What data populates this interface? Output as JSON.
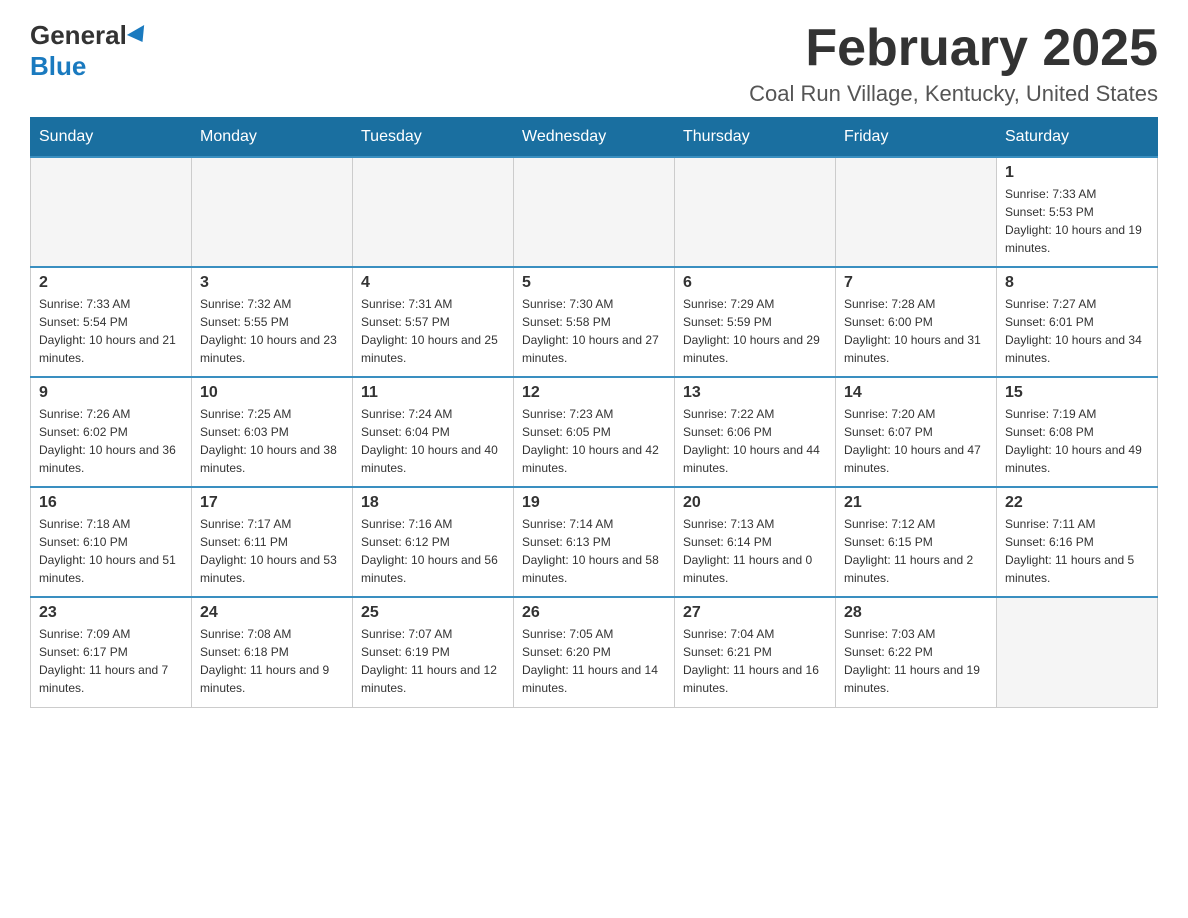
{
  "header": {
    "logo_general": "General",
    "logo_blue": "Blue",
    "month_title": "February 2025",
    "location": "Coal Run Village, Kentucky, United States"
  },
  "days_of_week": [
    "Sunday",
    "Monday",
    "Tuesday",
    "Wednesday",
    "Thursday",
    "Friday",
    "Saturday"
  ],
  "weeks": [
    [
      {
        "day": "",
        "info": ""
      },
      {
        "day": "",
        "info": ""
      },
      {
        "day": "",
        "info": ""
      },
      {
        "day": "",
        "info": ""
      },
      {
        "day": "",
        "info": ""
      },
      {
        "day": "",
        "info": ""
      },
      {
        "day": "1",
        "info": "Sunrise: 7:33 AM\nSunset: 5:53 PM\nDaylight: 10 hours and 19 minutes."
      }
    ],
    [
      {
        "day": "2",
        "info": "Sunrise: 7:33 AM\nSunset: 5:54 PM\nDaylight: 10 hours and 21 minutes."
      },
      {
        "day": "3",
        "info": "Sunrise: 7:32 AM\nSunset: 5:55 PM\nDaylight: 10 hours and 23 minutes."
      },
      {
        "day": "4",
        "info": "Sunrise: 7:31 AM\nSunset: 5:57 PM\nDaylight: 10 hours and 25 minutes."
      },
      {
        "day": "5",
        "info": "Sunrise: 7:30 AM\nSunset: 5:58 PM\nDaylight: 10 hours and 27 minutes."
      },
      {
        "day": "6",
        "info": "Sunrise: 7:29 AM\nSunset: 5:59 PM\nDaylight: 10 hours and 29 minutes."
      },
      {
        "day": "7",
        "info": "Sunrise: 7:28 AM\nSunset: 6:00 PM\nDaylight: 10 hours and 31 minutes."
      },
      {
        "day": "8",
        "info": "Sunrise: 7:27 AM\nSunset: 6:01 PM\nDaylight: 10 hours and 34 minutes."
      }
    ],
    [
      {
        "day": "9",
        "info": "Sunrise: 7:26 AM\nSunset: 6:02 PM\nDaylight: 10 hours and 36 minutes."
      },
      {
        "day": "10",
        "info": "Sunrise: 7:25 AM\nSunset: 6:03 PM\nDaylight: 10 hours and 38 minutes."
      },
      {
        "day": "11",
        "info": "Sunrise: 7:24 AM\nSunset: 6:04 PM\nDaylight: 10 hours and 40 minutes."
      },
      {
        "day": "12",
        "info": "Sunrise: 7:23 AM\nSunset: 6:05 PM\nDaylight: 10 hours and 42 minutes."
      },
      {
        "day": "13",
        "info": "Sunrise: 7:22 AM\nSunset: 6:06 PM\nDaylight: 10 hours and 44 minutes."
      },
      {
        "day": "14",
        "info": "Sunrise: 7:20 AM\nSunset: 6:07 PM\nDaylight: 10 hours and 47 minutes."
      },
      {
        "day": "15",
        "info": "Sunrise: 7:19 AM\nSunset: 6:08 PM\nDaylight: 10 hours and 49 minutes."
      }
    ],
    [
      {
        "day": "16",
        "info": "Sunrise: 7:18 AM\nSunset: 6:10 PM\nDaylight: 10 hours and 51 minutes."
      },
      {
        "day": "17",
        "info": "Sunrise: 7:17 AM\nSunset: 6:11 PM\nDaylight: 10 hours and 53 minutes."
      },
      {
        "day": "18",
        "info": "Sunrise: 7:16 AM\nSunset: 6:12 PM\nDaylight: 10 hours and 56 minutes."
      },
      {
        "day": "19",
        "info": "Sunrise: 7:14 AM\nSunset: 6:13 PM\nDaylight: 10 hours and 58 minutes."
      },
      {
        "day": "20",
        "info": "Sunrise: 7:13 AM\nSunset: 6:14 PM\nDaylight: 11 hours and 0 minutes."
      },
      {
        "day": "21",
        "info": "Sunrise: 7:12 AM\nSunset: 6:15 PM\nDaylight: 11 hours and 2 minutes."
      },
      {
        "day": "22",
        "info": "Sunrise: 7:11 AM\nSunset: 6:16 PM\nDaylight: 11 hours and 5 minutes."
      }
    ],
    [
      {
        "day": "23",
        "info": "Sunrise: 7:09 AM\nSunset: 6:17 PM\nDaylight: 11 hours and 7 minutes."
      },
      {
        "day": "24",
        "info": "Sunrise: 7:08 AM\nSunset: 6:18 PM\nDaylight: 11 hours and 9 minutes."
      },
      {
        "day": "25",
        "info": "Sunrise: 7:07 AM\nSunset: 6:19 PM\nDaylight: 11 hours and 12 minutes."
      },
      {
        "day": "26",
        "info": "Sunrise: 7:05 AM\nSunset: 6:20 PM\nDaylight: 11 hours and 14 minutes."
      },
      {
        "day": "27",
        "info": "Sunrise: 7:04 AM\nSunset: 6:21 PM\nDaylight: 11 hours and 16 minutes."
      },
      {
        "day": "28",
        "info": "Sunrise: 7:03 AM\nSunset: 6:22 PM\nDaylight: 11 hours and 19 minutes."
      },
      {
        "day": "",
        "info": ""
      }
    ]
  ]
}
